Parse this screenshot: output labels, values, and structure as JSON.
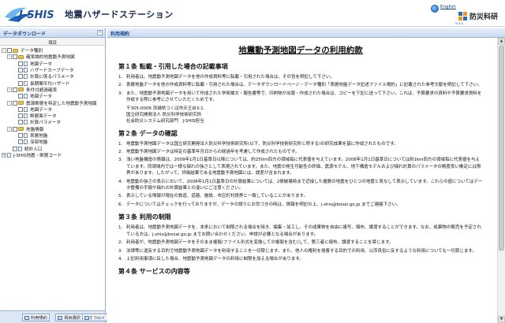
{
  "header": {
    "logo_text": "J-SHIS",
    "title": "地震ハザードステーション",
    "english_link": "English",
    "org_name": "防災科研",
    "org_sub": "NIED"
  },
  "left_panel": {
    "title": "データダウンロード",
    "column_header": "項目",
    "tree": [
      {
        "indent": 0,
        "toggle": "-",
        "checkbox": true,
        "icon": "folder",
        "label": "データ種別",
        "selected": false
      },
      {
        "indent": 1,
        "toggle": "-",
        "checkbox": true,
        "icon": "folder",
        "label": "確率論的地震動予測地図",
        "selected": false
      },
      {
        "indent": 2,
        "toggle": "",
        "checkbox": true,
        "icon": "doc",
        "label": "地図データ",
        "selected": false
      },
      {
        "indent": 2,
        "toggle": "",
        "checkbox": true,
        "icon": "doc",
        "label": "ハザードカーブデータ",
        "selected": false
      },
      {
        "indent": 2,
        "toggle": "",
        "checkbox": true,
        "icon": "doc",
        "label": "計算に係るパラメータ",
        "selected": false
      },
      {
        "indent": 2,
        "toggle": "",
        "checkbox": true,
        "icon": "doc",
        "label": "長期間平均ハザード",
        "selected": false
      },
      {
        "indent": 1,
        "toggle": "-",
        "checkbox": true,
        "icon": "folder",
        "label": "条件付超過確率",
        "selected": false
      },
      {
        "indent": 2,
        "toggle": "",
        "checkbox": true,
        "icon": "doc",
        "label": "地図データ",
        "selected": false
      },
      {
        "indent": 1,
        "toggle": "-",
        "checkbox": true,
        "icon": "folder",
        "label": "震源断層を特定した地震動予測地図",
        "selected": false
      },
      {
        "indent": 2,
        "toggle": "",
        "checkbox": true,
        "icon": "doc",
        "label": "地図データ",
        "selected": false
      },
      {
        "indent": 2,
        "toggle": "",
        "checkbox": true,
        "icon": "doc",
        "label": "断層面データ",
        "selected": false
      },
      {
        "indent": 2,
        "toggle": "",
        "checkbox": true,
        "icon": "doc",
        "label": "計算パラメータ",
        "selected": false
      },
      {
        "indent": 1,
        "toggle": "-",
        "checkbox": true,
        "icon": "folder",
        "label": "地盤情報",
        "selected": false
      },
      {
        "indent": 2,
        "toggle": "",
        "checkbox": true,
        "icon": "doc",
        "label": "表層地盤",
        "selected": false
      },
      {
        "indent": 2,
        "toggle": "",
        "checkbox": true,
        "icon": "doc",
        "label": "深部地盤",
        "selected": false
      },
      {
        "indent": 1,
        "toggle": "",
        "checkbox": true,
        "icon": "doc",
        "label": "統計人口",
        "selected": false
      },
      {
        "indent": 0,
        "toggle": "+",
        "checkbox": false,
        "icon": "doc",
        "label": "J-SHIS地震・断層コード",
        "selected": false
      }
    ],
    "buttons": {
      "terms": "利用規約",
      "select": "項目選択",
      "download": "ﾀﾞｳﾝﾛｰﾄﾞ"
    }
  },
  "right_panel": {
    "title": "利用規約",
    "doc_title": "地震動予測地図データの利用約款",
    "sections": [
      {
        "title": "第１条 転載・引用した場合の記載事項",
        "items": [
          {
            "num": "1.",
            "text": "利用者は、地震動予測地図データを他の作成資料等に転載・引用された場合は、その旨を明記して下さい。"
          },
          {
            "num": "2.",
            "text": "表層地盤データを他の作成資料等に転載・引用された場合は、データダウンロードページ・データ種別「表層地盤データ記述ファイル規約」に記載された参考文献を明記して下さい。"
          },
          {
            "num": "3.",
            "text": "また、地震動予測地図データを用いて作成された学術論文・報告書等で、印刷物が出版・作成された場合は、コピーを下記に送って下さい。これは、予算要求の資料や予算要求資料を作成する際に参考にさせていただくためです。"
          }
        ],
        "address": [
          "〒305-0006 茨城県つくば市天王台3-1",
          "国立研究開発法人 防災科学技術研究所",
          "社会防災システム研究部門　J-SHIS担当"
        ]
      },
      {
        "title": "第２条 データの確認",
        "items": [
          {
            "num": "1.",
            "text": "地震動予測地図データは国立研究開発法人防災科学技術研究所(以下、防災科学技術研究所と称する)の研究成果を基に作成されたものです。"
          },
          {
            "num": "2.",
            "text": "地震動予測地図データは特定の基準年月日からの経過年を考慮して作成されたものです。"
          },
          {
            "num": "3.",
            "text": "浅い地盤構造の情報は、2009年1月1日基準日以降については、約250m四方の領域毎に代表値を与えています。2008年1月1日基準日については約1km四方の領域毎に代表値を与えています。同領域内では一様な揺れの強さとして表現されています。また、地震の発生可能性の評価、震源モデル、地下構造モデルおよび揺れ計算のパラメータの精度良い推定には限界があります。したがって、評価結果である地震動予測地図には、誤差が含まれます。"
          },
          {
            "num": "4.",
            "text": "地震動の強さの表示において、2008年1月1日基準日の計算結果については、2発破壊時まで近接した複数の地震をひとつの地震と見なして表示しています。これらの値についてはデータ整備の手順や揺れの計算結果との違いにご注意ください。"
          },
          {
            "num": "5.",
            "text": "表示している情報が現在の鉄道、道路、施設、市区町村境界と一致していることがあります。"
          },
          {
            "num": "6.",
            "text": "データについてはチェックを行っておりますが、データの誤りにお気づきの時は、情報を明記の上、j-shis@bosai.go.jp までご連絡下さい。"
          }
        ]
      },
      {
        "title": "第３条 利用の制限",
        "items": [
          {
            "num": "1.",
            "text": "利用者は、地震動予測地図データを、本条において制限される場合を除き、編集・加工し、その成果物を自由に複写、頒布、譲渡することができます。なお、成果物の販売を予定されている方は、j-shis@bosai.go.jp までお問い合わせください。申請が必要となる場合があります。"
          },
          {
            "num": "2.",
            "text": "利用者が、地震動予測地図データをそのまま複製(ファイル形式を変換しての複製を含む)して、第三者に頒布、譲渡することを禁じます。"
          },
          {
            "num": "3.",
            "text": "法律等に違反する目的で地震動予測地図データを利用することを一切禁じます。また、他人の権利を侵害する目的での利用、公序良俗に反するような利用についても一切禁じます。"
          },
          {
            "num": "4.",
            "text": "上記利用事項に反した場合、地震動予測地図データの利用に制限を加える場合があります。"
          }
        ]
      },
      {
        "title": "第４条 サービスの内容等",
        "items": []
      }
    ]
  }
}
